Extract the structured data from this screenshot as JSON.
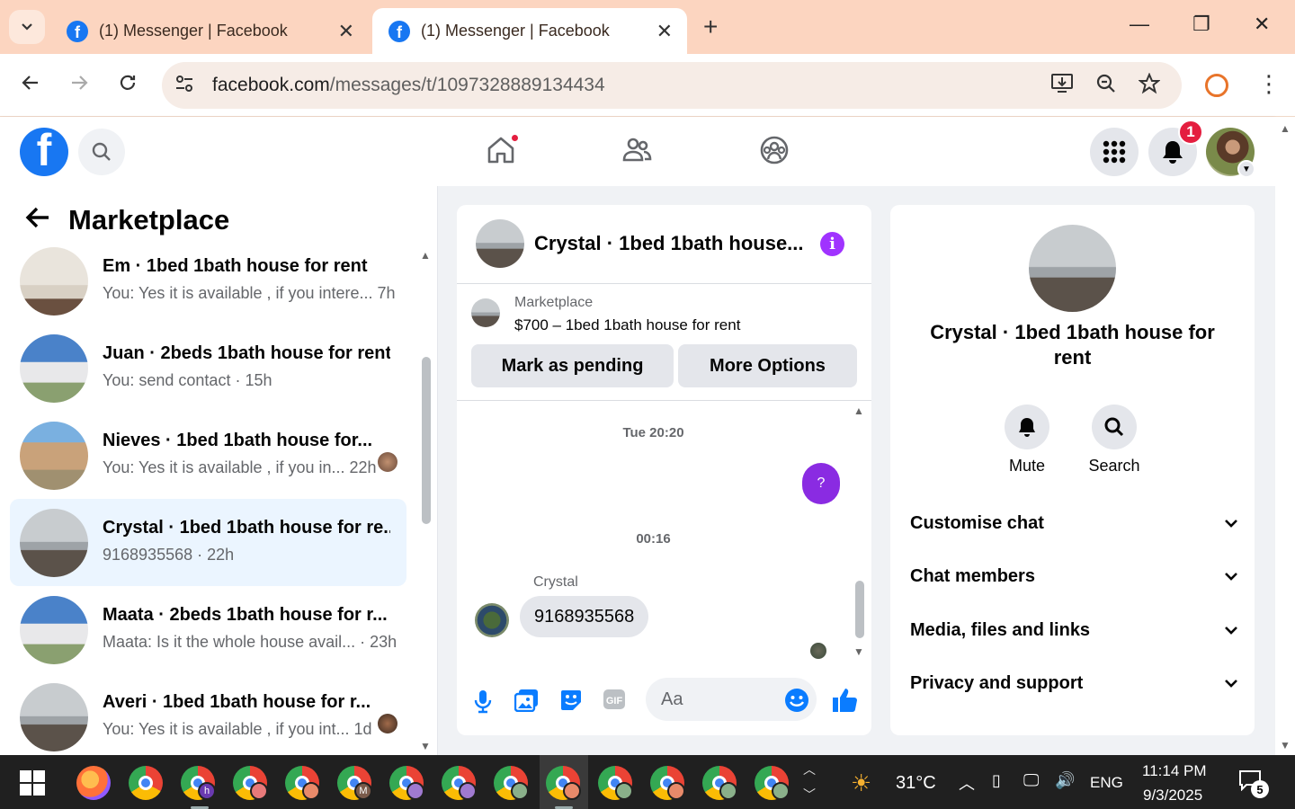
{
  "browser": {
    "tabs": [
      {
        "title": "(1) Messenger | Facebook",
        "active": false
      },
      {
        "title": "(1) Messenger | Facebook",
        "active": true
      }
    ],
    "url_domain": "facebook.com",
    "url_path": "/messages/t/1097328889134434"
  },
  "header": {
    "notifications_count": "1",
    "brand_color": "#1877f2"
  },
  "sidebar": {
    "title": "Marketplace",
    "conversations": [
      {
        "name": "Em · 1bed 1bath house for rent",
        "snippet": "You: Yes it is available , if you intere... 7h",
        "avatar": "bedroom"
      },
      {
        "name": "Juan · 2beds 1bath house for rent",
        "snippet": "You: send contact · 15h",
        "avatar": "house"
      },
      {
        "name": "Nieves · 1bed 1bath house for...",
        "snippet": "You: Yes it is available , if you in... 22h",
        "avatar": "house-front"
      },
      {
        "name": "Crystal · 1bed 1bath house for re...",
        "snippet": "9168935568 · 22h",
        "avatar": "room",
        "selected": true
      },
      {
        "name": "Maata · 2beds 1bath house for r...",
        "snippet": "Maata: Is it the whole house avail... · 23h",
        "avatar": "house"
      },
      {
        "name": "Averi · 1bed 1bath house for r...",
        "snippet": "You: Yes it is available , if you int... 1d",
        "avatar": "room"
      }
    ]
  },
  "chat": {
    "title": "Crystal · 1bed 1bath house...",
    "marketplace_label": "Marketplace",
    "listing": "$700 – 1bed 1bath house for rent",
    "mark_pending_label": "Mark as pending",
    "more_options_label": "More Options",
    "timestamp_1": "Tue 20:20",
    "outgoing_1": "?",
    "timestamp_2": "00:16",
    "sender_name": "Crystal",
    "incoming_1": "9168935568",
    "input_placeholder": "Aa",
    "accent_color": "#0a7cff"
  },
  "info_panel": {
    "name": "Crystal · 1bed 1bath house for rent",
    "mute_label": "Mute",
    "search_label": "Search",
    "sections": [
      "Customise chat",
      "Chat members",
      "Media, files and links",
      "Privacy and support"
    ]
  },
  "taskbar": {
    "temperature": "31°C",
    "language": "ENG",
    "time": "11:14 PM",
    "date": "9/3/2025",
    "notification_count": "5"
  }
}
